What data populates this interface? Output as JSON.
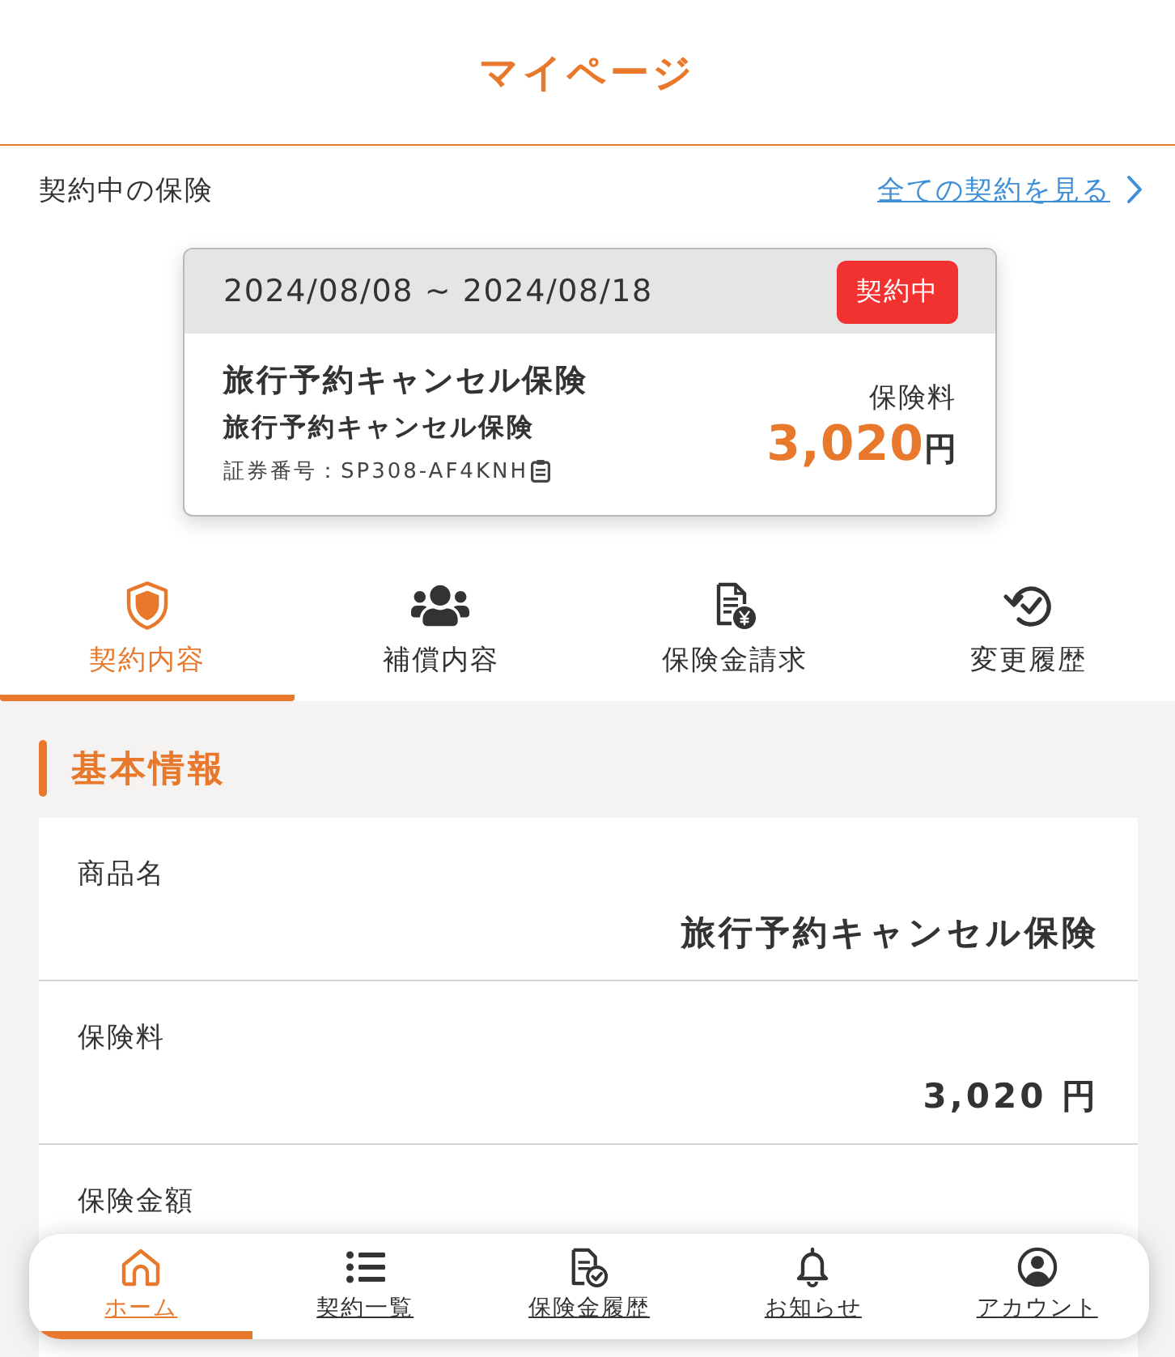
{
  "header": {
    "title": "マイページ"
  },
  "active_contracts": {
    "heading": "契約中の保険",
    "link": "全ての契約を見る"
  },
  "contract_card": {
    "period": "2024/08/08 ~ 2024/08/18",
    "status": "契約中",
    "product_name": "旅行予約キャンセル保険",
    "plan_name": "旅行予約キャンセル保険",
    "policy_number": "証券番号：SP308-AF4KNH",
    "premium_label": "保険料",
    "premium_amount": "3,020",
    "premium_unit": "円"
  },
  "tabs": [
    {
      "label": "契約内容",
      "selected": true
    },
    {
      "label": "補償内容",
      "selected": false
    },
    {
      "label": "保険金請求",
      "selected": false
    },
    {
      "label": "変更履歴",
      "selected": false
    }
  ],
  "section": {
    "title": "基本情報",
    "rows": [
      {
        "label": "商品名",
        "value": "旅行予約キャンセル保険"
      },
      {
        "label": "保険料",
        "value": "3,020 円"
      },
      {
        "label": "保険金額"
      }
    ]
  },
  "bottom_nav": [
    {
      "label": "ホーム",
      "selected": true
    },
    {
      "label": "契約一覧",
      "selected": false
    },
    {
      "label": "保険金履歴",
      "selected": false
    },
    {
      "label": "お知らせ",
      "selected": false
    },
    {
      "label": "アカウント",
      "selected": false
    }
  ]
}
